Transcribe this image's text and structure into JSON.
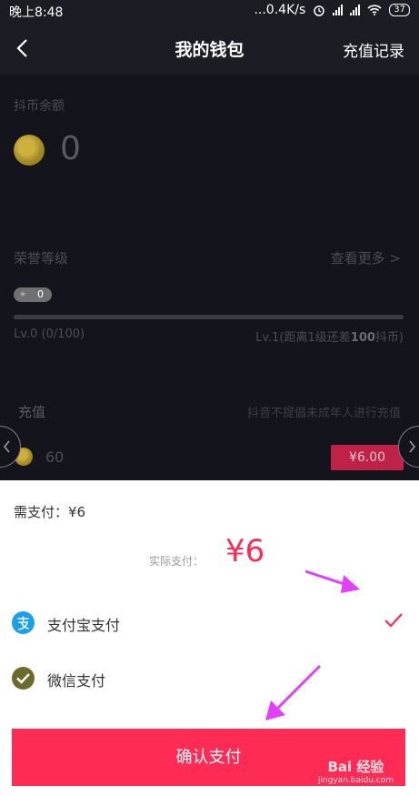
{
  "status_bar": {
    "time": "晚上8:48",
    "net_speed": "...0.4K/s",
    "battery": "37"
  },
  "header": {
    "title": "我的钱包",
    "right_action": "充值记录",
    "back_icon": "chevron-left-icon"
  },
  "balance": {
    "label": "抖币余额",
    "value": "0",
    "icon": "coin-icon"
  },
  "honor": {
    "label": "荣誉等级",
    "see_more": "查看更多 >",
    "badge_level": "0",
    "progress_percent": 0,
    "current_level": "Lv.0 (0/100)",
    "next_level_prefix": "Lv.1(距离1级还差",
    "next_level_amount": "100",
    "next_level_suffix": "抖币)"
  },
  "recharge": {
    "label": "充值",
    "note": "抖音不提倡未成年人进行充值",
    "coin_amount": "60",
    "price": "¥6.00"
  },
  "payment_sheet": {
    "need_pay": "需支付：¥6",
    "actual_label": "实际支付：",
    "actual_value": "¥6",
    "options": [
      {
        "label": "支付宝支付",
        "icon": "alipay-icon",
        "selected": true
      },
      {
        "label": "微信支付",
        "icon": "wechat-pay-icon",
        "selected": false
      }
    ],
    "confirm": "确认支付"
  },
  "watermark": {
    "top": "Bai 经验",
    "bottom": "jingyan.baidu.com"
  },
  "colors": {
    "accent": "#fe2c55",
    "dark_bg": "#14141c",
    "alipay": "#1aa0e8",
    "wechat_olive": "#6b6b2c"
  }
}
